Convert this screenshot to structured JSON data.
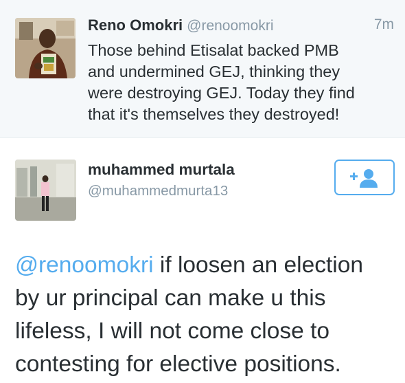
{
  "parent_tweet": {
    "author_name": "Reno Omokri",
    "author_handle": "@renoomokri",
    "timestamp": "7m",
    "text_lines": [
      "Those behind Etisalat backed PMB",
      "and undermined GEJ, thinking they",
      "were destroying GEJ. Today they find",
      "that it's themselves they destroyed!"
    ],
    "avatar_icon": "user-avatar-photo"
  },
  "main_tweet": {
    "author_name": "muhammed murtala",
    "author_handle": "@muhammedmurta13",
    "avatar_icon": "user-avatar-photo",
    "follow_icon": "add-user-icon",
    "mention": "@renoomokri",
    "text_first_line_rest": " if loosen an election",
    "text_lines": [
      "by ur principal can make u this",
      "lifeless, I will not come close to",
      "contesting for elective positions."
    ]
  },
  "colors": {
    "accent": "#55acee",
    "secondary_text": "#8899a6",
    "primary_text": "#292f33",
    "parent_background": "#f5f8fa"
  }
}
